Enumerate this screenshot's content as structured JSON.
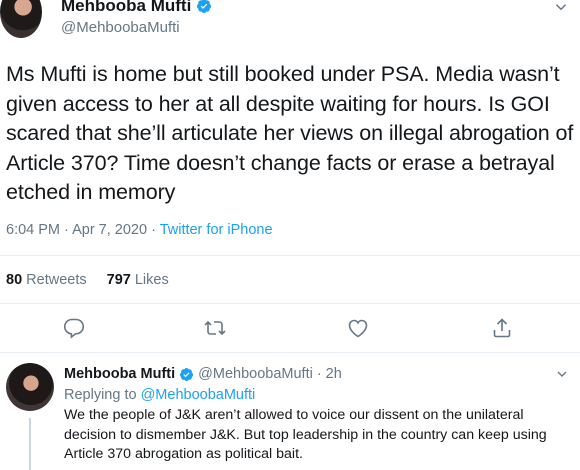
{
  "colors": {
    "accent": "#1da1f2",
    "muted": "#657786",
    "text": "#14171a",
    "divider": "#e6ecf0"
  },
  "main_tweet": {
    "author_name": "Mehbooba Mufti",
    "author_handle": "@MehboobaMufti",
    "verified_icon": "verified-badge-icon",
    "text": "Ms Mufti is home but still booked under PSA. Media wasn’t given access to her at all despite waiting for hours. Is GOI scared that she’ll articulate her views on illegal abrogation of Article 370? Time doesn’t change facts or erase a betrayal etched in memory",
    "time": "6:04 PM · Apr 7, 2020 · ",
    "source": "Twitter for iPhone",
    "retweets_count": "80",
    "retweets_label": "Retweets",
    "likes_count": "797",
    "likes_label": "Likes",
    "actions": [
      "reply-icon",
      "retweet-icon",
      "like-icon",
      "share-icon"
    ]
  },
  "reply_tweet": {
    "author_name": "Mehbooba Mufti",
    "author_handle": "@MehboobaMufti",
    "separator": "·",
    "time_ago": "2h",
    "replying_prefix": "Replying to",
    "replying_mention": "@MehboobaMufti",
    "text": "We the people of J&K aren’t allowed to voice our dissent on the unilateral decision to dismember J&K. But top leadership in the country can keep using Article 370 abrogation as political bait."
  }
}
